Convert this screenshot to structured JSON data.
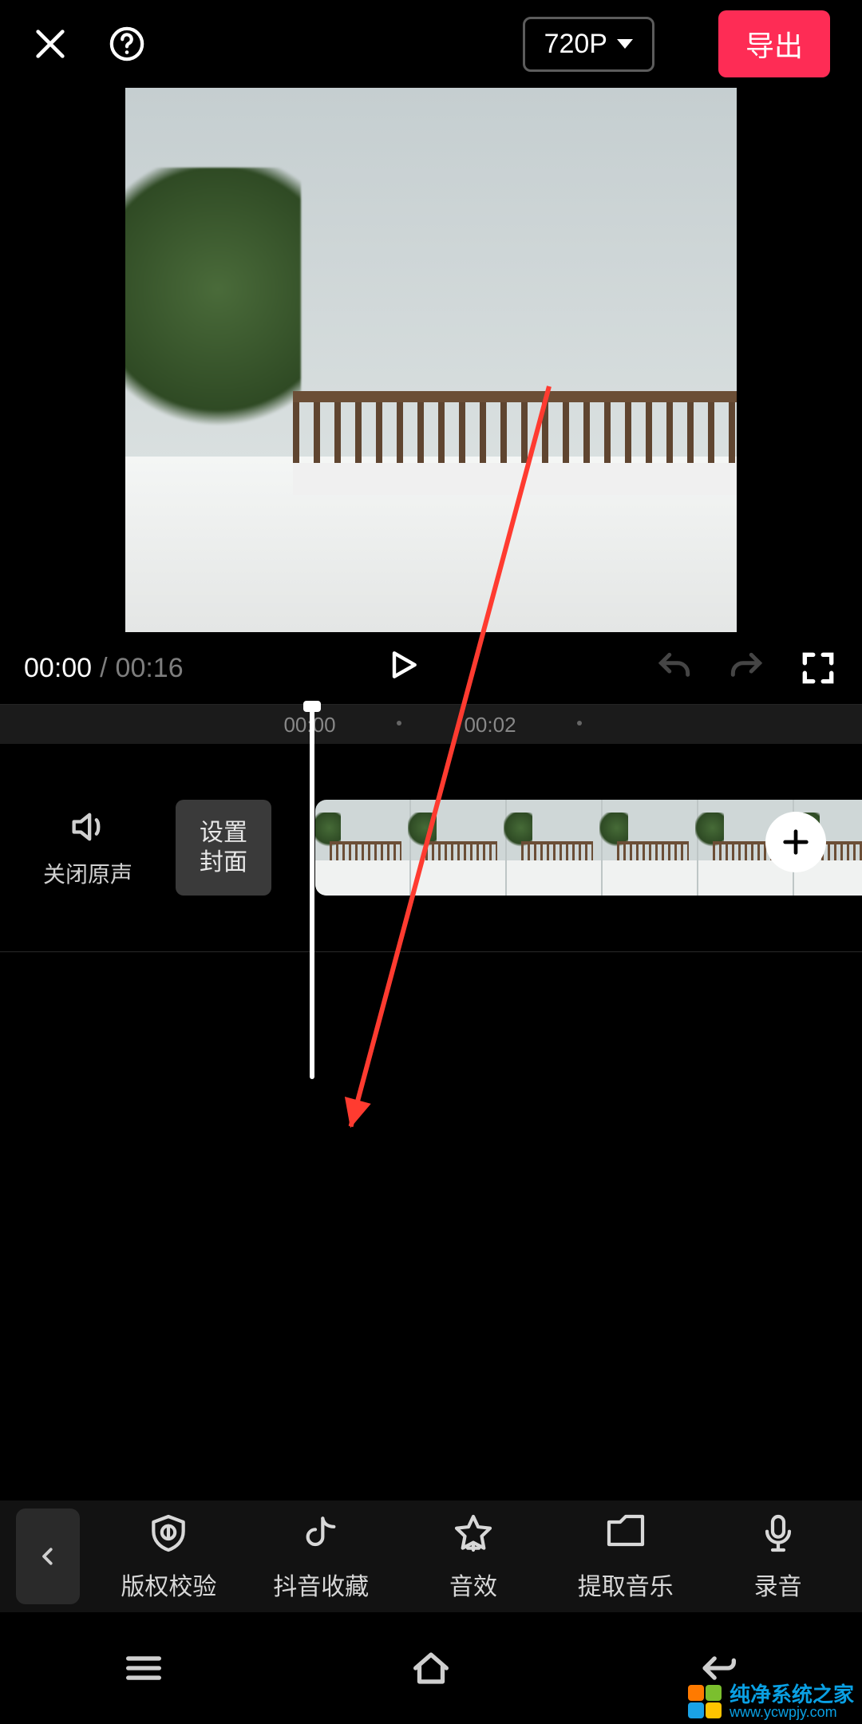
{
  "header": {
    "resolution_label": "720P",
    "export_label": "导出"
  },
  "player": {
    "current_time": "00:00",
    "separator": "/",
    "total_time": "00:16"
  },
  "ruler": {
    "marks": [
      "00:00",
      "00:02"
    ]
  },
  "track": {
    "mute_label": "关闭原声",
    "cover_label": "设置\n封面"
  },
  "toolbar": {
    "items": [
      {
        "id": "copyright",
        "label": "版权校验"
      },
      {
        "id": "douyin-fav",
        "label": "抖音收藏"
      },
      {
        "id": "sound-fx",
        "label": "音效"
      },
      {
        "id": "extract",
        "label": "提取音乐"
      },
      {
        "id": "record",
        "label": "录音"
      }
    ]
  },
  "watermark": {
    "title": "纯净系统之家",
    "url": "www.ycwpjy.com"
  },
  "colors": {
    "accent": "#fe2c55",
    "arrow": "#ff3b30"
  }
}
